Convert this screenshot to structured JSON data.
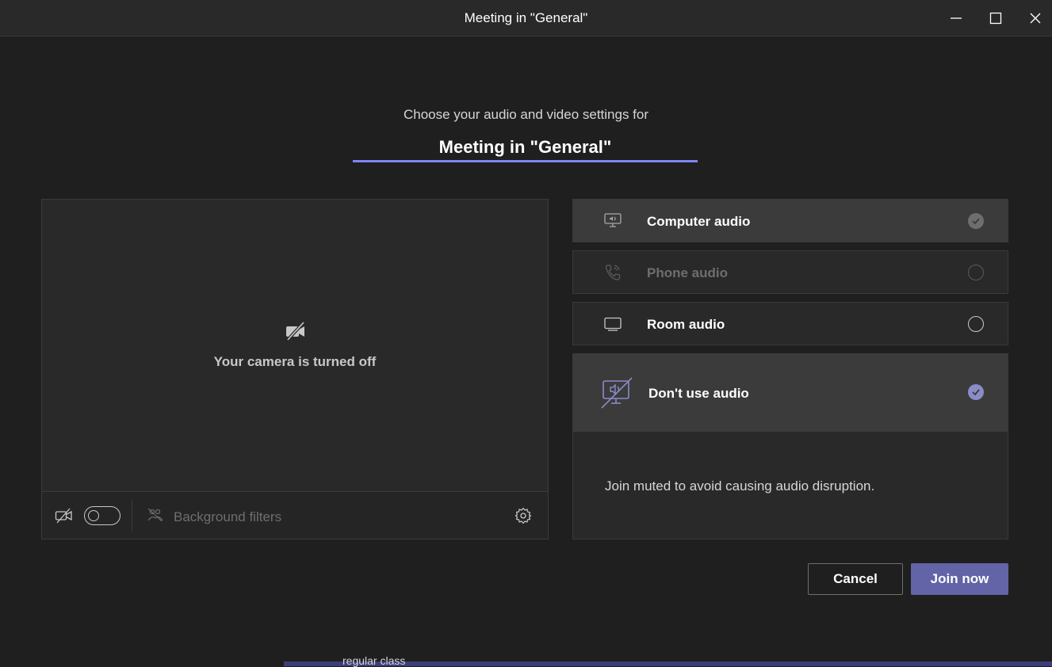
{
  "window": {
    "title": "Meeting in \"General\"",
    "controls": [
      "minimize-icon",
      "maximize-icon",
      "close-icon"
    ]
  },
  "header": {
    "subtitle": "Choose your audio and video settings for",
    "meeting_name": "Meeting in \"General\""
  },
  "preview": {
    "camera_off_text": "Your camera is turned off",
    "camera_toggle_on": false,
    "background_filters_label": "Background filters"
  },
  "audio_options": [
    {
      "label": "Computer audio",
      "icon": "computer-audio-icon",
      "state": "checked-disabled"
    },
    {
      "label": "Phone audio",
      "icon": "phone-audio-icon",
      "state": "disabled"
    },
    {
      "label": "Room audio",
      "icon": "room-audio-icon",
      "state": "unchecked"
    },
    {
      "label": "Don't use audio",
      "icon": "no-audio-icon",
      "state": "checked",
      "description": "Join muted to avoid causing audio disruption."
    }
  ],
  "actions": {
    "cancel_label": "Cancel",
    "join_label": "Join now"
  },
  "taskbar_peek_text": "regular class",
  "colors": {
    "accent": "#6264a7",
    "accent_light": "#7f85f5",
    "background": "#1f1f1f",
    "panel": "#292929"
  }
}
